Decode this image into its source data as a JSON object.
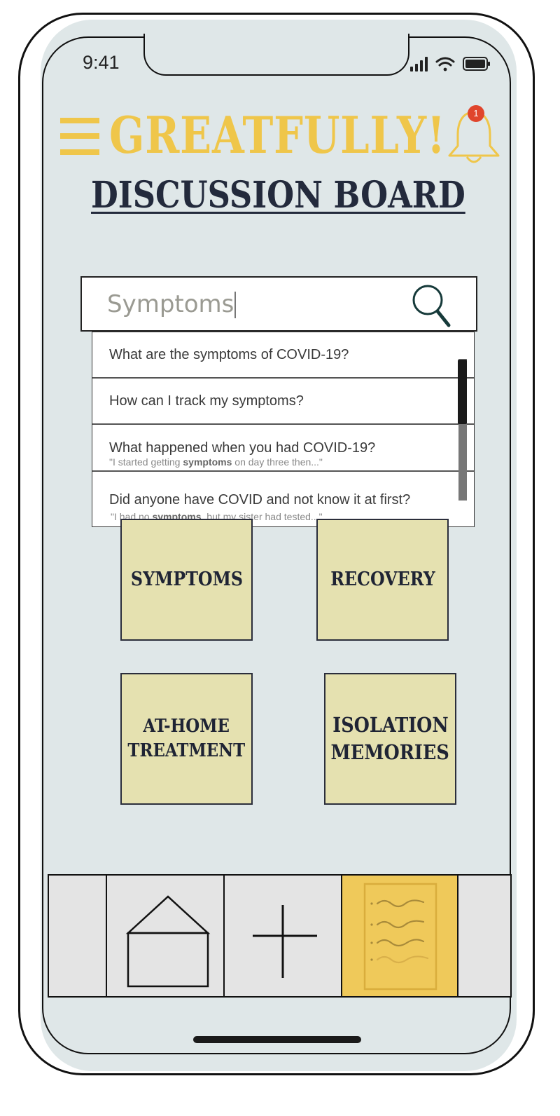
{
  "status_bar": {
    "time": "9:41"
  },
  "header": {
    "app_title": "GREATFULLY!",
    "notification_count": "1",
    "page_title": "DISCUSSION BOARD"
  },
  "search": {
    "value": "Symptoms"
  },
  "suggestions": [
    {
      "question": "What are the symptoms of COVID-19?"
    },
    {
      "question": "How can I track my symptoms?"
    },
    {
      "question": "What happened when you had COVID-19?",
      "snippet_before": "\"I started getting ",
      "snippet_bold": "symptoms",
      "snippet_after": " on day three then...\""
    },
    {
      "question": "Did anyone have COVID and not know it at first?",
      "snippet_before": "\"I had no ",
      "snippet_bold": "symptoms",
      "snippet_after": ", but my sister had tested...\""
    }
  ],
  "categories": [
    {
      "line1": "SYMPTOMS"
    },
    {
      "line1": "RECOVERY"
    },
    {
      "line1": "AT-HOME",
      "line2": "TREATMENT"
    },
    {
      "line1": "ISOLATION",
      "line2": "MEMORIES"
    }
  ],
  "colors": {
    "brand_yellow": "#efc64a",
    "title_navy": "#232a3c",
    "tile_fill": "#e5e1b0",
    "screen_bg": "#dfe7e8",
    "badge_red": "#e0452c",
    "active_nav": "#efc95a"
  },
  "bottom_nav": [
    {
      "icon": "home-icon"
    },
    {
      "icon": "plus-icon"
    },
    {
      "icon": "document-icon",
      "active": true
    }
  ]
}
